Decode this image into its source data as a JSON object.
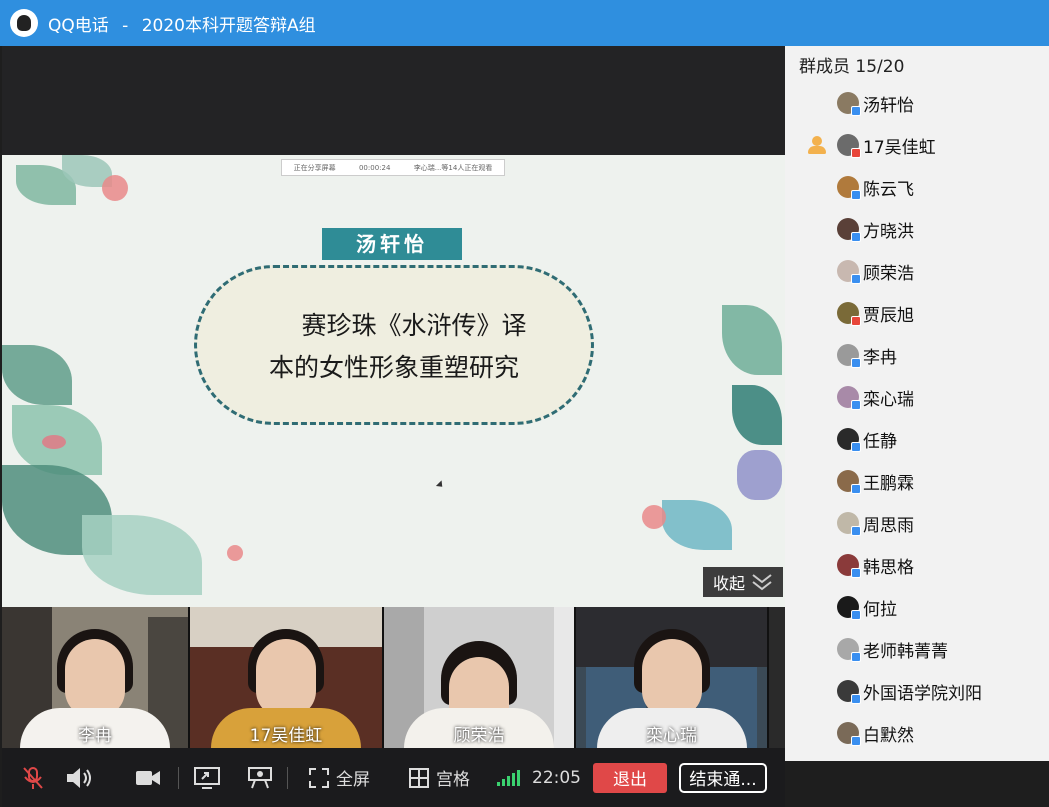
{
  "window": {
    "app_name": "QQ电话",
    "separator": "-",
    "group_name": "2020本科开题答辩A组"
  },
  "slide": {
    "share_bar": [
      "正在分享屏幕",
      "00:00:24",
      "李心瑞...等14人正在观看"
    ],
    "presenter": "汤轩怡",
    "title_line1": "赛珍珠《水浒传》译",
    "title_line2": "本的女性形象重塑研究",
    "collapse_label": "收起"
  },
  "video_tiles": [
    {
      "name": "李冉"
    },
    {
      "name": "17吴佳虹"
    },
    {
      "name": "顾荣浩"
    },
    {
      "name": "栾心瑞"
    }
  ],
  "toolbar": {
    "fullscreen_label": "全屏",
    "grid_label": "宫格",
    "time": "22:05",
    "exit_label": "退出",
    "end_label": "结束通..."
  },
  "members": {
    "header": "群成员 15/20",
    "items": [
      {
        "name": "汤轩怡",
        "avatar_color": "#8a7a62",
        "device": "blue",
        "host": false
      },
      {
        "name": "17吴佳虹",
        "avatar_color": "#6b6b6b",
        "device": "red",
        "host": true
      },
      {
        "name": "陈云飞",
        "avatar_color": "#b07a3c",
        "device": "blue",
        "host": false
      },
      {
        "name": "方晓洪",
        "avatar_color": "#5a4038",
        "device": "blue",
        "host": false
      },
      {
        "name": "顾荣浩",
        "avatar_color": "#c8b8b0",
        "device": "blue",
        "host": false
      },
      {
        "name": "贾辰旭",
        "avatar_color": "#7a6a38",
        "device": "red",
        "host": false
      },
      {
        "name": "李冉",
        "avatar_color": "#9a9a9a",
        "device": "blue",
        "host": false
      },
      {
        "name": "栾心瑞",
        "avatar_color": "#a88aa8",
        "device": "blue",
        "host": false
      },
      {
        "name": "任静",
        "avatar_color": "#2a2a2a",
        "device": "blue",
        "host": false
      },
      {
        "name": "王鹏霖",
        "avatar_color": "#8a6a4a",
        "device": "blue",
        "host": false
      },
      {
        "name": "周思雨",
        "avatar_color": "#c0b8a8",
        "device": "blue",
        "host": false
      },
      {
        "name": "韩思格",
        "avatar_color": "#8a3a3a",
        "device": "blue",
        "host": false
      },
      {
        "name": "何拉",
        "avatar_color": "#1a1a1a",
        "device": "blue",
        "host": false
      },
      {
        "name": "老师韩菁菁",
        "avatar_color": "#a8a8a8",
        "device": "blue",
        "host": false
      },
      {
        "name": "外国语学院刘阳",
        "avatar_color": "#3a3a3a",
        "device": "blue",
        "host": false
      },
      {
        "name": "白默然",
        "avatar_color": "#7a6a58",
        "device": "blue",
        "host": false
      }
    ]
  },
  "colors": {
    "titlebar": "#2f8fdf",
    "exit_button": "#e04848",
    "name_tag": "#2f8c96",
    "signal": "#3bd16f"
  }
}
